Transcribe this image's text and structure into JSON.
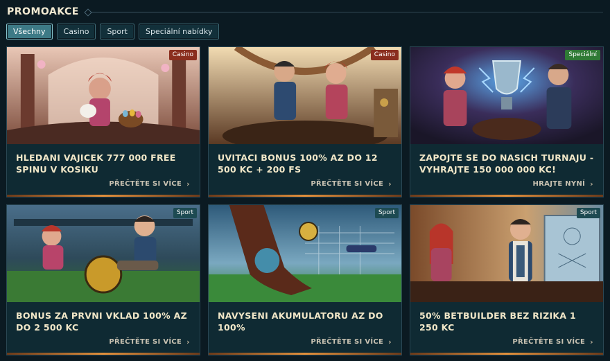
{
  "header": {
    "title": "PROMOAKCE"
  },
  "filters": [
    {
      "label": "Všechny",
      "active": true
    },
    {
      "label": "Casino",
      "active": false
    },
    {
      "label": "Sport",
      "active": false
    },
    {
      "label": "Speciální nabídky",
      "active": false
    }
  ],
  "cards": [
    {
      "badge": "Casino",
      "title": "HLEDANI VAJICEK 777 000 FREE SPINU V KOSIKU",
      "link": "PŘEČTĚTE SI VÍCE"
    },
    {
      "badge": "Casino",
      "title": "UVITACI BONUS 100% AZ DO 12 500 KC + 200 FS",
      "link": "PŘEČTĚTE SI VÍCE"
    },
    {
      "badge": "Speciální",
      "title": "ZAPOJTE SE DO NASICH TURNAJU - VYHRAJTE 150 000 000 KC!",
      "link": "HRAJTE NYNÍ"
    },
    {
      "badge": "Sport",
      "title": "BONUS ZA PRVNI VKLAD 100% AZ DO 2 500 KC",
      "link": "PŘEČTĚTE SI VÍCE"
    },
    {
      "badge": "Sport",
      "title": "NAVYSENI AKUMULATORU AZ DO 100%",
      "link": "PŘEČTĚTE SI VÍCE"
    },
    {
      "badge": "Sport",
      "title": "50% BETBUILDER BEZ RIZIKA 1 250 KC",
      "link": "PŘEČTĚTE SI VÍCE"
    }
  ]
}
